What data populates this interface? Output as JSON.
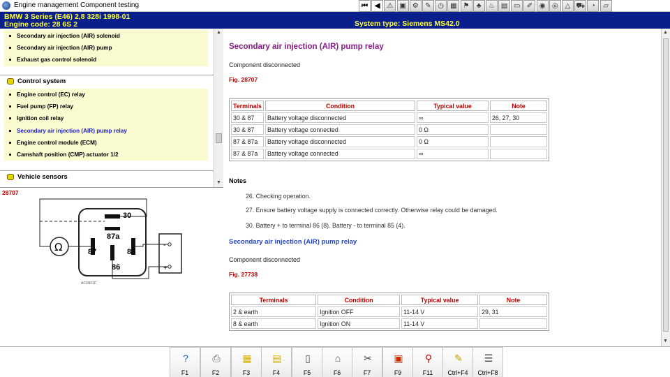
{
  "window": {
    "title": "Engine management Component testing"
  },
  "toolbar": {
    "buttons": [
      {
        "name": "first-page-button",
        "glyph": "⏮"
      },
      {
        "name": "previous-button",
        "glyph": "◀"
      },
      {
        "name": "warning-button",
        "glyph": "⚠"
      },
      {
        "name": "picture-button",
        "glyph": "▣"
      },
      {
        "name": "settings-button",
        "glyph": "⚙"
      },
      {
        "name": "tools-button",
        "glyph": "✎"
      },
      {
        "name": "clock-button",
        "glyph": "◷"
      },
      {
        "name": "calc-button",
        "glyph": "▦"
      },
      {
        "name": "flag-button",
        "glyph": "⚑"
      },
      {
        "name": "tree-button",
        "glyph": "♣"
      },
      {
        "name": "exhaust-button",
        "glyph": "♨"
      },
      {
        "name": "layers-button",
        "glyph": "▤"
      },
      {
        "name": "folder-button",
        "glyph": "▭"
      },
      {
        "name": "edit-button",
        "glyph": "✐"
      },
      {
        "name": "wheel-button",
        "glyph": "◉"
      },
      {
        "name": "camera-button",
        "glyph": "◎"
      },
      {
        "name": "alert-button",
        "glyph": "△"
      },
      {
        "name": "car-button",
        "glyph": "⛟"
      },
      {
        "name": "gauge-button",
        "glyph": "◔"
      },
      {
        "name": "note-button",
        "glyph": "▱"
      }
    ]
  },
  "header": {
    "vehicle": "BMW   3 Series (E46) 2,8 328i 1998-01",
    "engine_code": "Engine code: 28 6S 2",
    "system": "System type: Siemens MS42.0"
  },
  "sidebar": {
    "top_items": [
      {
        "label": "Secondary air injection (AIR) solenoid"
      },
      {
        "label": "Secondary air injection (AIR) pump"
      },
      {
        "label": "Exhaust gas control solenoid"
      }
    ],
    "groups": {
      "control": {
        "label": "Control system",
        "items": [
          {
            "label": "Engine control (EC) relay"
          },
          {
            "label": "Fuel pump (FP) relay"
          },
          {
            "label": "Ignition coil relay"
          },
          {
            "label": "Secondary air injection (AIR) pump relay",
            "active": true
          },
          {
            "label": "Engine control module (ECM)"
          },
          {
            "label": "Camshaft position (CMP) actuator 1/2"
          }
        ]
      },
      "sensors": {
        "label": "Vehicle sensors"
      }
    }
  },
  "diagram": {
    "fig": "28707",
    "pins": {
      "p30": "30",
      "p87a": "87a",
      "p87": "87",
      "p85": "85",
      "p86": "86"
    },
    "meter": {
      "plus": "+",
      "minus": "-"
    },
    "code": "ACU9F1F"
  },
  "main": {
    "section1": {
      "title": "Secondary air injection (AIR) pump relay",
      "status": "Component disconnected",
      "fig": "Fig. 28707",
      "headers": [
        "Terminals",
        "Condition",
        "Typical value",
        "Note"
      ],
      "rows": [
        [
          "30 & 87",
          "Battery voltage disconnected",
          " ∞",
          "26, 27, 30"
        ],
        [
          "30 & 87",
          "Battery voltage connected",
          "0 Ω",
          ""
        ],
        [
          "87 & 87a",
          "Battery voltage disconnected",
          "0 Ω",
          ""
        ],
        [
          "87 & 87a",
          "Battery voltage connected",
          " ∞",
          ""
        ]
      ]
    },
    "notes": {
      "title": "Notes",
      "items": [
        "26. Checking operation.",
        "27. Ensure battery voltage supply is connected correctly. Otherwise relay could be damaged.",
        "30. Battery + to terminal 86 (8). Battery - to terminal 85 (4)."
      ]
    },
    "section2": {
      "title": "Secondary air injection (AIR) pump relay",
      "status": "Component disconnected",
      "fig": "Fig. 27738",
      "headers": [
        "Terminals",
        "Condition",
        "Typical value",
        "Note"
      ],
      "rows": [
        [
          "2 & earth",
          "Ignition OFF",
          "11-14 V",
          "29, 31"
        ],
        [
          "8 & earth",
          "Ignition ON",
          "11-14 V",
          ""
        ]
      ]
    }
  },
  "function_keys": [
    {
      "label": "F1",
      "icon": "help-icon",
      "glyph": "?",
      "color": "#2060c0"
    },
    {
      "label": "F2",
      "icon": "printer-icon",
      "glyph": "⎙",
      "color": "#606060"
    },
    {
      "label": "F3",
      "icon": "folder-icon",
      "glyph": "▦",
      "color": "#d8b000"
    },
    {
      "label": "F4",
      "icon": "documents-icon",
      "glyph": "▤",
      "color": "#d8b000"
    },
    {
      "label": "F5",
      "icon": "page-icon",
      "glyph": "▯",
      "color": "#505050"
    },
    {
      "label": "F6",
      "icon": "component-icon",
      "glyph": "⌂",
      "color": "#505050"
    },
    {
      "label": "F7",
      "icon": "connector-icon",
      "glyph": "✂",
      "color": "#404040"
    },
    {
      "label": "F9",
      "icon": "diagram-icon",
      "glyph": "▣",
      "color": "#c03000"
    },
    {
      "label": "F11",
      "icon": "search-icon",
      "glyph": "⚲",
      "color": "#c00000"
    },
    {
      "label": "Ctrl+F4",
      "icon": "notepad-icon",
      "glyph": "✎",
      "color": "#c0a000"
    },
    {
      "label": "Ctrl+F8",
      "icon": "list-icon",
      "glyph": "☰",
      "color": "#404040"
    }
  ]
}
